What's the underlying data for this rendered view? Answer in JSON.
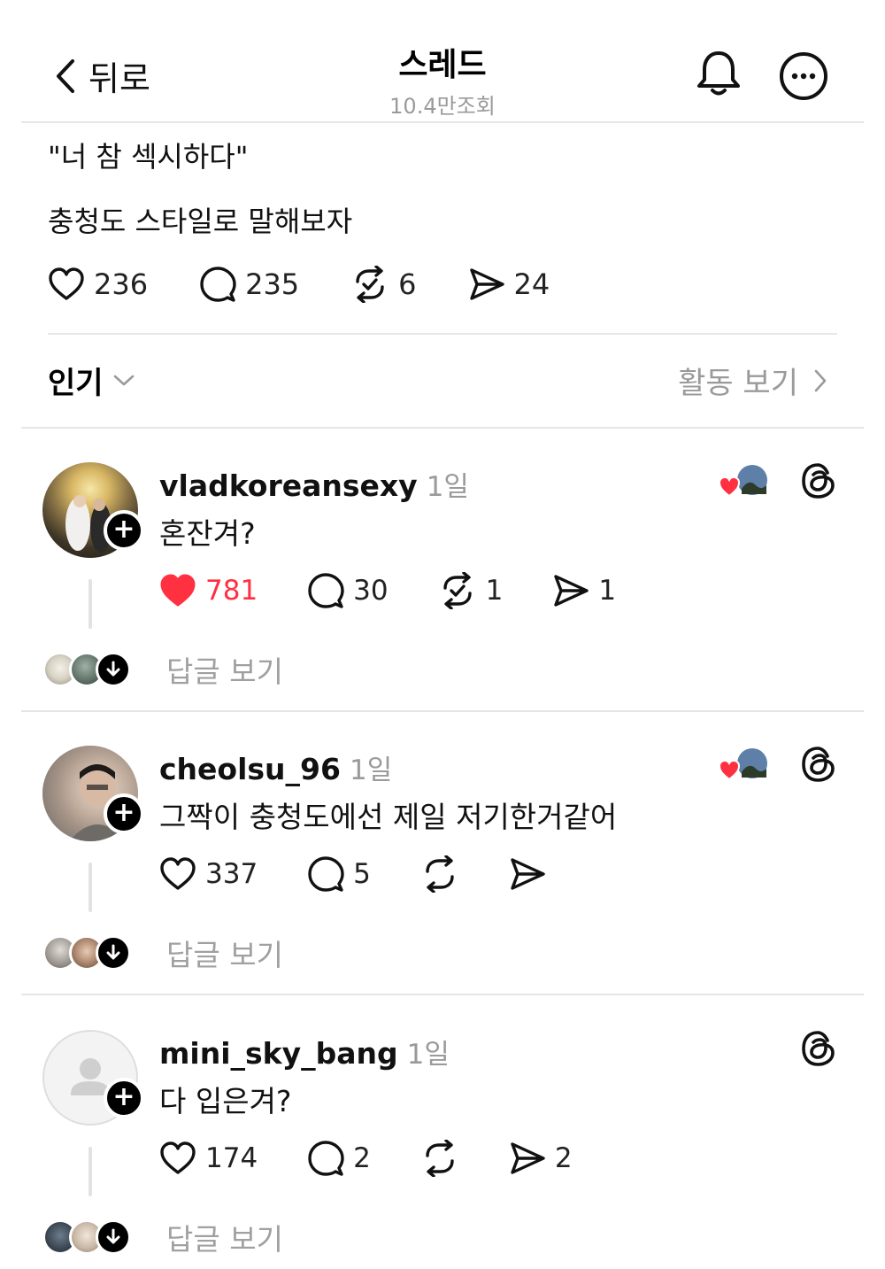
{
  "header": {
    "back_label": "뒤로",
    "title": "스레드",
    "views": "10.4만조회"
  },
  "post": {
    "line1": "\"너 참 섹시하다\"",
    "line2": "충청도 스타일로 말해보자",
    "likes": "236",
    "comments": "235",
    "reposts": "6",
    "shares": "24"
  },
  "sort": {
    "label": "인기",
    "activity_label": "활동 보기"
  },
  "comments": [
    {
      "username": "vladkoreansexy",
      "time": "1일",
      "text": "혼잔겨?",
      "likes": "781",
      "liked": true,
      "comments": "30",
      "reposts": "1",
      "shares": "1",
      "liked_by_author": true,
      "view_replies": "답글 보기"
    },
    {
      "username": "cheolsu_96",
      "time": "1일",
      "text": "그짝이 충청도에선 제일 저기한거같어",
      "likes": "337",
      "liked": false,
      "comments": "5",
      "reposts": "",
      "shares": "",
      "liked_by_author": true,
      "view_replies": "답글 보기"
    },
    {
      "username": "mini_sky_bang",
      "time": "1일",
      "text": "다 입은겨?",
      "likes": "174",
      "liked": false,
      "comments": "2",
      "reposts": "",
      "shares": "2",
      "liked_by_author": false,
      "view_replies": "답글 보기"
    }
  ],
  "colors": {
    "like_red": "#ff3040",
    "muted_text": "#9a9a9a",
    "divider": "#e6e6e6"
  }
}
